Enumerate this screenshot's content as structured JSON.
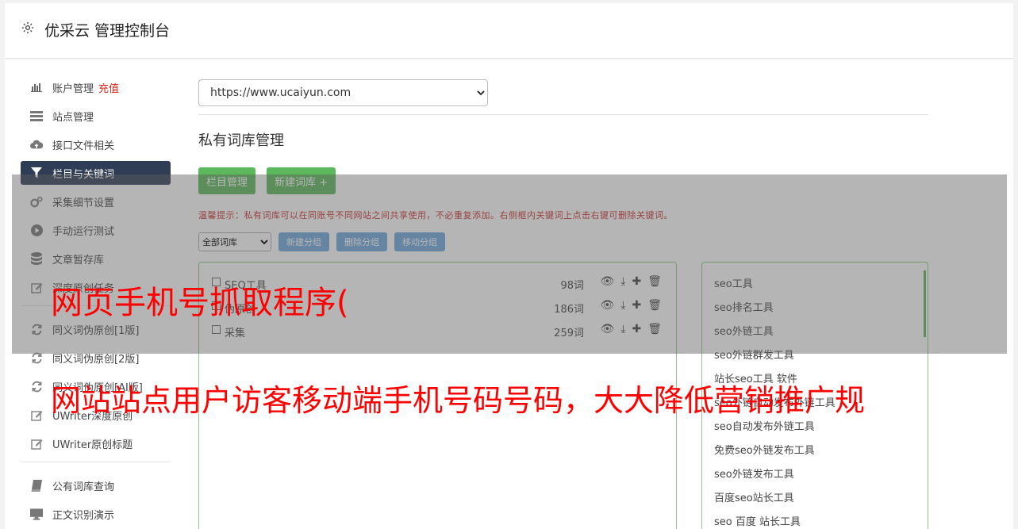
{
  "header": {
    "title": "优采云 管理控制台",
    "icon": "gear-icon"
  },
  "sidebar": {
    "items": [
      {
        "label": "账户管理",
        "badge": "充值",
        "icon": "bar-chart-icon",
        "active": false
      },
      {
        "label": "站点管理",
        "icon": "server-icon",
        "active": false
      },
      {
        "label": "接口文件相关",
        "icon": "cloud-upload-icon",
        "active": false
      },
      {
        "label": "栏目与关键词",
        "icon": "filter-icon",
        "active": true
      },
      {
        "label": "采集细节设置",
        "icon": "cogs-icon",
        "active": false
      },
      {
        "label": "手动运行测试",
        "icon": "play-circle-icon",
        "active": false
      },
      {
        "label": "文章暂存库",
        "icon": "database-icon",
        "active": false
      },
      {
        "label": "深度原创任务",
        "icon": "edit-icon",
        "active": false
      }
    ],
    "items2": [
      {
        "label": "同义词伪原创[1版]",
        "icon": "refresh-icon"
      },
      {
        "label": "同义词伪原创[2版]",
        "icon": "refresh-icon"
      },
      {
        "label": "同义词伪原创[AI版]",
        "icon": "refresh-icon"
      },
      {
        "label": "UWriter深度原创",
        "icon": "edit-icon"
      },
      {
        "label": "UWriter原创标题",
        "icon": "edit-icon"
      }
    ],
    "items3": [
      {
        "label": "公有词库查询",
        "icon": "book-icon"
      },
      {
        "label": "正文识别演示",
        "icon": "monitor-icon"
      }
    ]
  },
  "main": {
    "site_select": "https://www.ucaiyun.com",
    "section_title": "私有词库管理",
    "buttons": {
      "column_manage": "栏目管理",
      "new_lib": "新建词库 +"
    },
    "tip": "温馨提示：私有词库可以在同账号不同网站之间共享使用，不必重复添加。右侧框内关键词上点击右键可删除关键词。",
    "group_select": "全部词库",
    "group_buttons": {
      "new_group": "新建分组",
      "delete_group": "删除分组",
      "move_group": "移动分组"
    },
    "libraries": [
      {
        "name": "SEO工具",
        "count": "98词"
      },
      {
        "name": "伪原创",
        "count": "186词"
      },
      {
        "name": "采集",
        "count": "259词"
      }
    ],
    "keywords": [
      "seo工具",
      "seo排名工具",
      "seo外链工具",
      "seo外链群发工具",
      "站长seo工具 软件",
      "seo外链自动发布外链工具",
      "seo自动发布外链工具",
      "免费seo外链发布工具",
      "seo外链发布工具",
      "百度seo站长工具",
      "seo 百度 站长工具"
    ]
  },
  "overlay_ad": {
    "line1": "网页手机号抓取程序(",
    "line2": "网站站点用户访客移动端手机号码号码，大大降低营销推广规"
  },
  "colors": {
    "active_nav": "#2f3e55",
    "green_btn": "#5cb85c",
    "blue_btn": "#6fa8dc",
    "tip_red": "#c9302c",
    "ad_red": "#ff0000"
  }
}
